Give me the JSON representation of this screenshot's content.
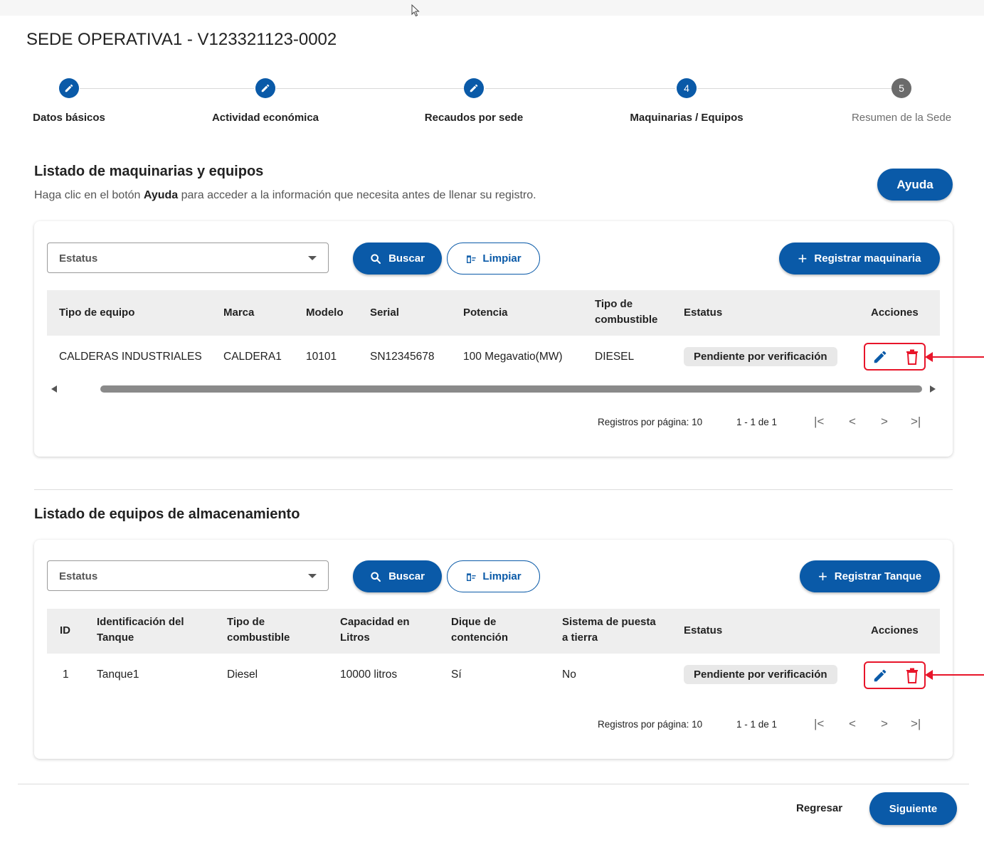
{
  "page": {
    "title": "SEDE OPERATIVA1 - V123321123-0002"
  },
  "stepper": {
    "steps": [
      {
        "label": "Datos básicos",
        "state": "done",
        "number": ""
      },
      {
        "label": "Actividad económica",
        "state": "done",
        "number": ""
      },
      {
        "label": "Recaudos por sede",
        "state": "done",
        "number": ""
      },
      {
        "label": "Maquinarias / Equipos",
        "state": "active",
        "number": "4"
      },
      {
        "label": "Resumen de la Sede",
        "state": "pending",
        "number": "5"
      }
    ]
  },
  "machinery": {
    "section_title": "Listado de maquinarias y equipos",
    "hint_prefix": "Haga clic en el botón ",
    "hint_bold": "Ayuda",
    "hint_suffix": " para acceder a la información que necesita antes de llenar su registro.",
    "help_button": "Ayuda",
    "status_placeholder": "Estatus",
    "search_button": "Buscar",
    "clear_button": "Limpiar",
    "register_button": "Registrar maquinaria",
    "columns": [
      "Tipo de equipo",
      "Marca",
      "Modelo",
      "Serial",
      "Potencia",
      "Tipo de\ncombustible",
      "Estatus",
      "Acciones"
    ],
    "rows": [
      {
        "tipo": "CALDERAS INDUSTRIALES",
        "marca": "CALDERA1",
        "modelo": "10101",
        "serial": "SN12345678",
        "potencia": "100 Megavatio(MW)",
        "combustible": "DIESEL",
        "estatus": "Pendiente por verificación"
      }
    ],
    "pager": {
      "per_page": "Registros por página: 10",
      "range": "1 - 1 de 1"
    }
  },
  "storage": {
    "section_title": "Listado de equipos de almacenamiento",
    "status_placeholder": "Estatus",
    "search_button": "Buscar",
    "clear_button": "Limpiar",
    "register_button": "Registrar Tanque",
    "columns": [
      "ID",
      "Identificación del\nTanque",
      "Tipo de\ncombustible",
      "Capacidad en\nLitros",
      "Dique de\ncontención",
      "Sistema de puesta\na tierra",
      "Estatus",
      "Acciones"
    ],
    "rows": [
      {
        "id": "1",
        "identificacion": "Tanque1",
        "combustible": "Diesel",
        "capacidad": "10000 litros",
        "dique": "Sí",
        "puesta_tierra": "No",
        "estatus": "Pendiente por verificación"
      }
    ],
    "pager": {
      "per_page": "Registros por página: 10",
      "range": "1 - 1 de 1"
    }
  },
  "footer": {
    "back_button": "Regresar",
    "next_button": "Siguiente"
  },
  "colors": {
    "primary": "#0a5aa8",
    "danger": "#e8152a",
    "badge_bg": "#e8e8e8"
  },
  "icons": {
    "step_done": "pencil-icon",
    "search": "search-icon",
    "clear": "filter-clear-icon",
    "add": "plus-icon",
    "edit": "pencil-icon",
    "delete": "trash-icon",
    "first": "first-page-icon",
    "prev": "chevron-left-icon",
    "next": "chevron-right-icon",
    "last": "last-page-icon"
  }
}
